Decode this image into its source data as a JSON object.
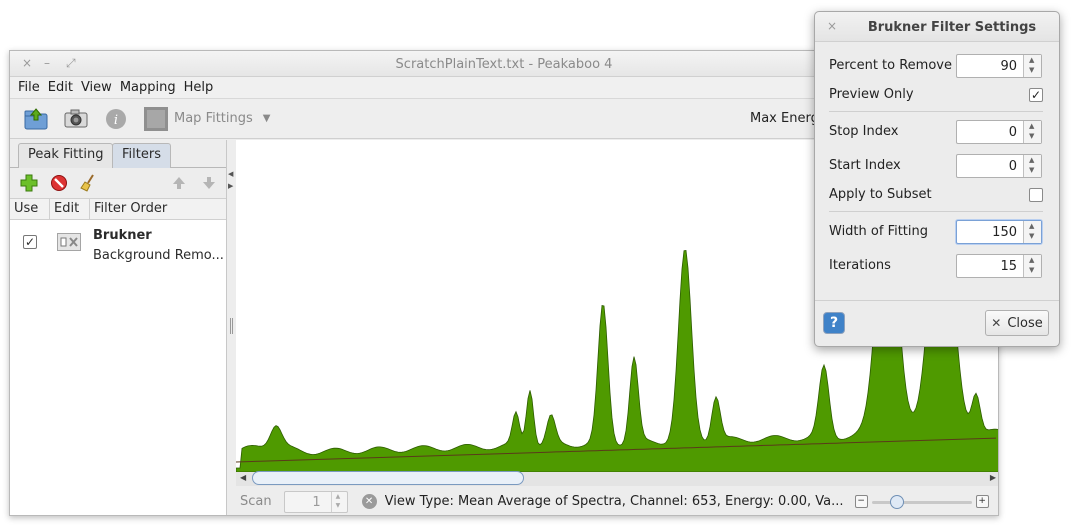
{
  "window": {
    "title": "ScratchPlainText.txt - Peakaboo 4",
    "close_glyph": "×",
    "minimize_glyph": "–",
    "maximize_glyph": "⤢"
  },
  "menu": [
    "File",
    "Edit",
    "View",
    "Mapping",
    "Help"
  ],
  "toolbar": {
    "map_fittings_label": "Map Fittings",
    "max_energy_label": "Max Energ"
  },
  "left_panel": {
    "tabs": [
      "Peak Fitting",
      "Filters"
    ],
    "columns": [
      "Use",
      "Edit",
      "Filter Order"
    ],
    "filters": [
      {
        "name": "Brukner",
        "description": "Background Remo...",
        "enabled": "✓"
      }
    ]
  },
  "status": {
    "scan_label": "Scan",
    "scan_value": "1",
    "view_info": "View Type: Mean Average of Spectra,  Channel: 653,  Energy: 0.00,  Va..."
  },
  "dialog": {
    "title": "Brukner Filter Settings",
    "close_glyph": "×",
    "rows": {
      "percent_to_remove": {
        "label": "Percent to Remove",
        "value": "90"
      },
      "preview_only": {
        "label": "Preview Only",
        "checked": "✓"
      },
      "stop_index": {
        "label": "Stop Index",
        "value": "0"
      },
      "start_index": {
        "label": "Start Index",
        "value": "0"
      },
      "apply_to_subset": {
        "label": "Apply to Subset",
        "checked": ""
      },
      "width_of_fitting": {
        "label": "Width of Fitting",
        "value": "150"
      },
      "iterations": {
        "label": "Iterations",
        "value": "15"
      }
    },
    "help_glyph": "?",
    "close_button_label": "Close",
    "close_button_glyph": "✕"
  },
  "colors": {
    "spectrum_fill": "#4f9a00",
    "spectrum_outline": "#2d5c00",
    "background_line": "#5a3a1a"
  }
}
